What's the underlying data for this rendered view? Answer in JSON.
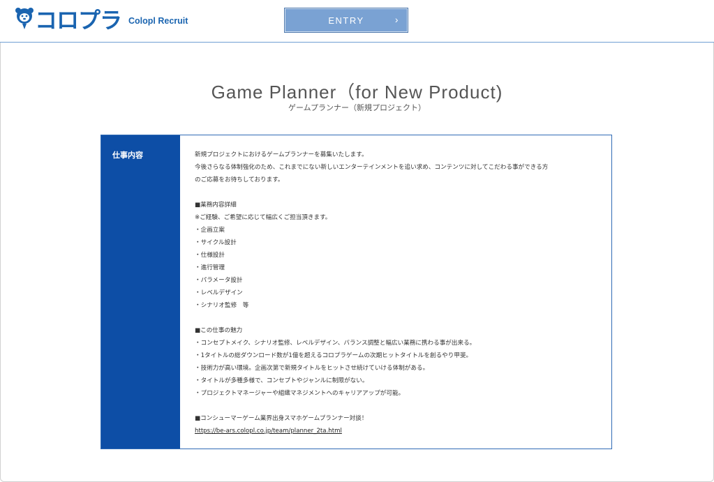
{
  "header": {
    "logo_text": "コロプラ",
    "logo_sub": "Colopl Recruit",
    "entry_label": "ENTRY",
    "entry_arrow": "›"
  },
  "page": {
    "title": "Game Planner（for New Product)",
    "subtitle": "ゲームプランナー（新規プロジェクト）"
  },
  "job": {
    "label": "仕事内容",
    "intro": [
      "新規プロジェクトにおけるゲームプランナーを募集いたします。",
      "今後さらなる体制強化のため、これまでにない新しいエンターテインメントを追い求め、コンテンツに対してこだわる事ができる方",
      "のご応募をお待ちしております。"
    ],
    "details_heading": "■業務内容詳細",
    "details_note": "※ご経験、ご希望に応じて幅広くご担当頂きます。",
    "details": [
      "・企画立案",
      "・サイクル設計",
      "・仕様設計",
      "・進行管理",
      "・パラメータ設計",
      "・レベルデザイン",
      "・シナリオ監修　等"
    ],
    "appeal_heading": "■この仕事の魅力",
    "appeal": [
      "・コンセプトメイク、シナリオ監修、レベルデザイン、バランス調整と幅広い業務に携わる事が出来る。",
      "・1タイトルの総ダウンロード数が1億を超えるコロプラゲームの次期ヒットタイトルを創るやり甲斐。",
      "・技術力が高い環境。企画次第で新規タイトルをヒットさせ続けていける体制がある。",
      "・タイトルが多種多様で、コンセプトやジャンルに制限がない。",
      "・プロジェクトマネージャーや組織マネジメントへのキャリアアップが可能。"
    ],
    "talk_heading": "■コンシューマーゲーム業界出身スマホゲームプランナー対談！",
    "talk_link": "https://be-ars.colopl.co.jp/team/planner_2ta.html"
  }
}
